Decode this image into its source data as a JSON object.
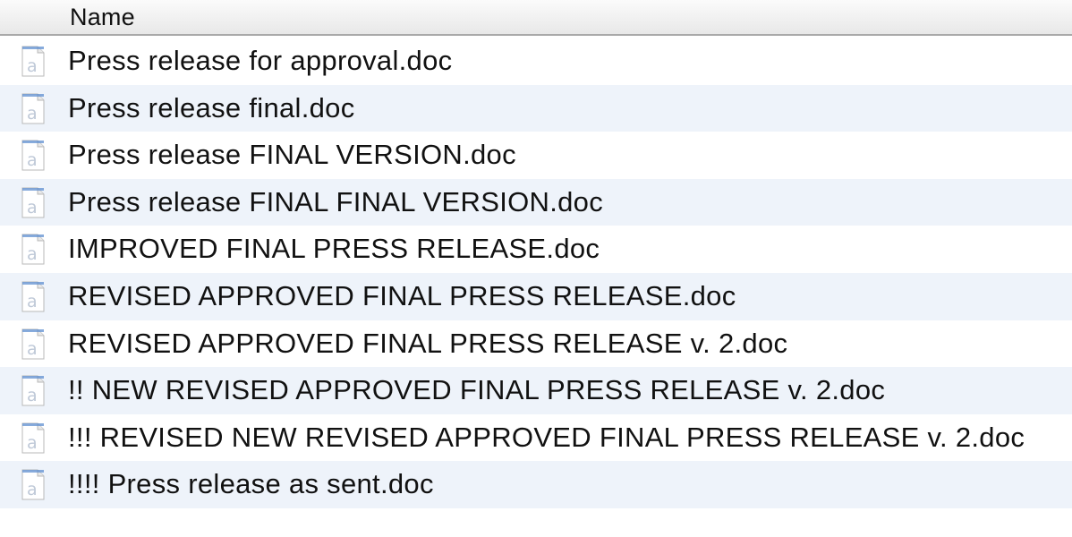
{
  "header": {
    "name_label": "Name"
  },
  "files": [
    {
      "name": "Press release for approval.doc",
      "icon": "document-icon"
    },
    {
      "name": "Press release final.doc",
      "icon": "document-icon"
    },
    {
      "name": "Press release FINAL VERSION.doc",
      "icon": "document-icon"
    },
    {
      "name": "Press release FINAL FINAL VERSION.doc",
      "icon": "document-icon"
    },
    {
      "name": "IMPROVED FINAL PRESS RELEASE.doc",
      "icon": "document-icon"
    },
    {
      "name": "REVISED APPROVED FINAL PRESS RELEASE.doc",
      "icon": "document-icon"
    },
    {
      "name": "REVISED APPROVED FINAL PRESS RELEASE v. 2.doc",
      "icon": "document-icon"
    },
    {
      "name": "!! NEW REVISED APPROVED FINAL PRESS RELEASE v. 2.doc",
      "icon": "document-icon"
    },
    {
      "name": "!!! REVISED NEW REVISED APPROVED FINAL PRESS RELEASE v. 2.doc",
      "icon": "document-icon"
    },
    {
      "name": "!!!! Press release as sent.doc",
      "icon": "document-icon"
    }
  ],
  "colors": {
    "alt_row": "#eef3fa",
    "header_border": "#a9a9a9",
    "icon_blue": "#5f8fd0"
  }
}
